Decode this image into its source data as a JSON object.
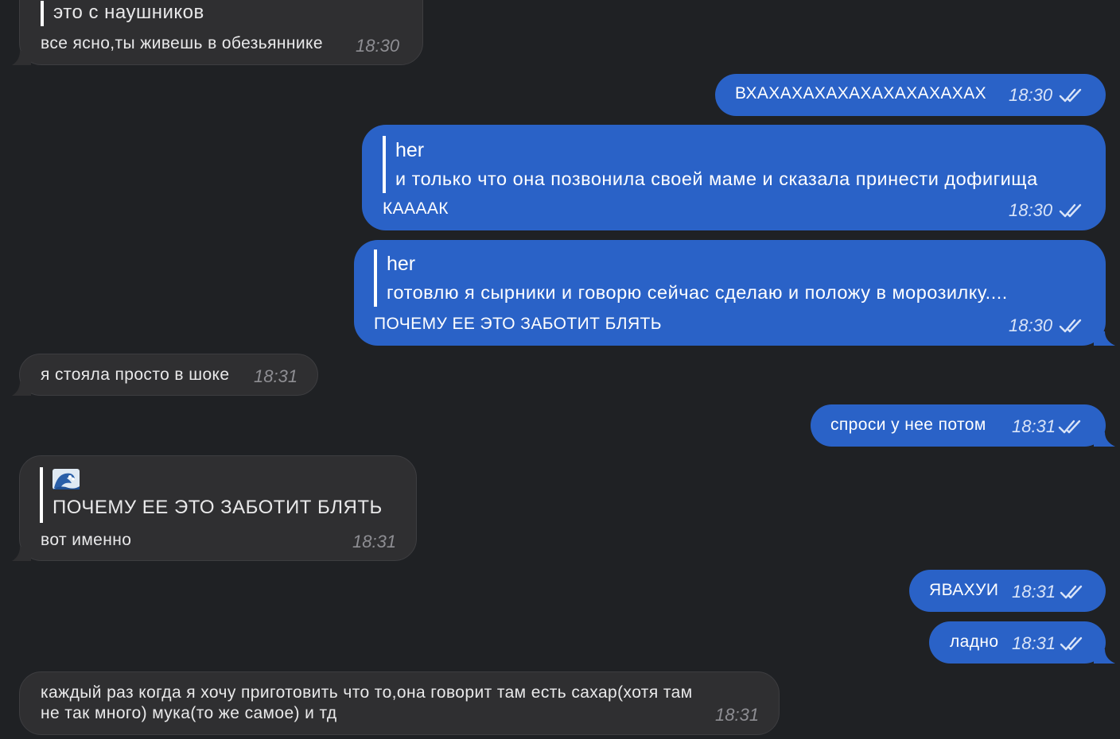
{
  "messages": [
    {
      "id": "m1",
      "direction": "in",
      "quote_text": "это с наушников",
      "text": "все ясно,ты живешь в обезьяннике",
      "time": "18:30"
    },
    {
      "id": "m2",
      "direction": "out",
      "text": "ВХАХАХАХАХАХАХАХАХАХАХ",
      "time": "18:30",
      "status": "read"
    },
    {
      "id": "m3",
      "direction": "out",
      "quote_name": "her",
      "quote_text": "и только что она позвонила своей маме и сказала принести дофигища",
      "text": "КААААК",
      "time": "18:30",
      "status": "read"
    },
    {
      "id": "m4",
      "direction": "out",
      "quote_name": "her",
      "quote_text": "готовлю я сырники и говорю сейчас сделаю и положу в морозилку....",
      "text": "ПОЧЕМУ ЕЕ ЭТО ЗАБОТИТ БЛЯТЬ",
      "time": "18:30",
      "status": "read"
    },
    {
      "id": "m5",
      "direction": "in",
      "text": "я стояла просто в шоке",
      "time": "18:31"
    },
    {
      "id": "m6",
      "direction": "out",
      "text": "спроси у нее потом",
      "time": "18:31",
      "status": "read"
    },
    {
      "id": "m7",
      "direction": "in",
      "quote_icon": "wave-emoji-icon",
      "quote_text": "ПОЧЕМУ ЕЕ ЭТО ЗАБОТИТ БЛЯТЬ",
      "text": "вот именно",
      "time": "18:31"
    },
    {
      "id": "m8",
      "direction": "out",
      "text": "ЯВАХУИ",
      "time": "18:31",
      "status": "read"
    },
    {
      "id": "m9",
      "direction": "out",
      "text": "ладно",
      "time": "18:31",
      "status": "read"
    },
    {
      "id": "m10",
      "direction": "in",
      "text_line1": "каждый раз когда я хочу приготовить что то,она говорит там есть сахар(хотя там",
      "text_line2": "не так много) мука(то же самое) и тд",
      "time": "18:31"
    }
  ],
  "colors": {
    "background": "#1f2124",
    "incoming_bubble": "#2f2f31",
    "outgoing_bubble": "#2a62c7"
  }
}
